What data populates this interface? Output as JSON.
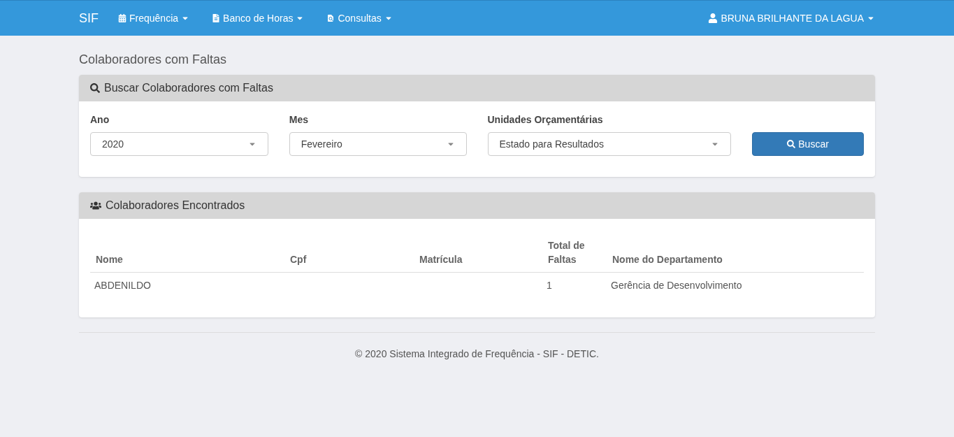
{
  "navbar": {
    "brand": "SIF",
    "menus": [
      {
        "label": "Frequência"
      },
      {
        "label": "Banco de Horas"
      },
      {
        "label": "Consultas"
      }
    ],
    "user": "BRUNA BRILHANTE DA LAGUA"
  },
  "page_title": "Colaboradores com Faltas",
  "search_panel": {
    "title": "Buscar Colaboradores com Faltas",
    "fields": [
      {
        "label": "Ano",
        "value": "2020"
      },
      {
        "label": "Mes",
        "value": "Fevereiro"
      },
      {
        "label": "Unidades Orçamentárias",
        "value": "Estado para Resultados"
      }
    ],
    "button": "Buscar"
  },
  "results_panel": {
    "title": "Colaboradores Encontrados",
    "table": {
      "columns": [
        "Nome",
        "Cpf",
        "Matrícula",
        "Total de Faltas",
        "Nome do Departamento"
      ],
      "rows": [
        {
          "cells": [
            "ABDENILDO",
            null,
            null,
            "1",
            "Gerência de Desenvolvimento"
          ]
        }
      ]
    }
  },
  "footer": "© 2020 Sistema Integrado de Frequência - SIF - DETIC."
}
